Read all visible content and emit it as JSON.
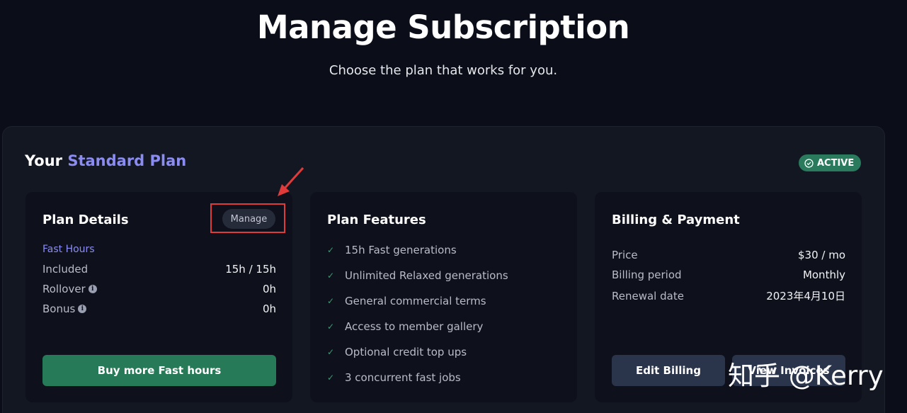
{
  "header": {
    "title": "Manage Subscription",
    "subtitle": "Choose the plan that works for you."
  },
  "plan": {
    "prefix": "Your",
    "name": "Standard Plan",
    "status": "ACTIVE",
    "status_color": "#2a7a5d",
    "accent_color": "#8a8cf2"
  },
  "plan_details": {
    "title": "Plan Details",
    "manage_label": "Manage",
    "section_label": "Fast Hours",
    "rows": [
      {
        "label": "Included",
        "value": "15h / 15h"
      },
      {
        "label": "Rollover",
        "value": "0h"
      },
      {
        "label": "Bonus",
        "value": "0h"
      }
    ],
    "info_icon": "i",
    "buy_button": "Buy more Fast hours"
  },
  "plan_features": {
    "title": "Plan Features",
    "items": [
      "15h Fast generations",
      "Unlimited Relaxed generations",
      "General commercial terms",
      "Access to member gallery",
      "Optional credit top ups",
      "3 concurrent fast jobs"
    ]
  },
  "billing": {
    "title": "Billing & Payment",
    "rows": [
      {
        "label": "Price",
        "value": "$30 / mo"
      },
      {
        "label": "Billing period",
        "value": "Monthly"
      },
      {
        "label": "Renewal date",
        "value": "2023年4月10日"
      }
    ],
    "edit_button": "Edit Billing",
    "invoices_button": "View Invoices"
  },
  "watermark": "知乎 @Kerry"
}
